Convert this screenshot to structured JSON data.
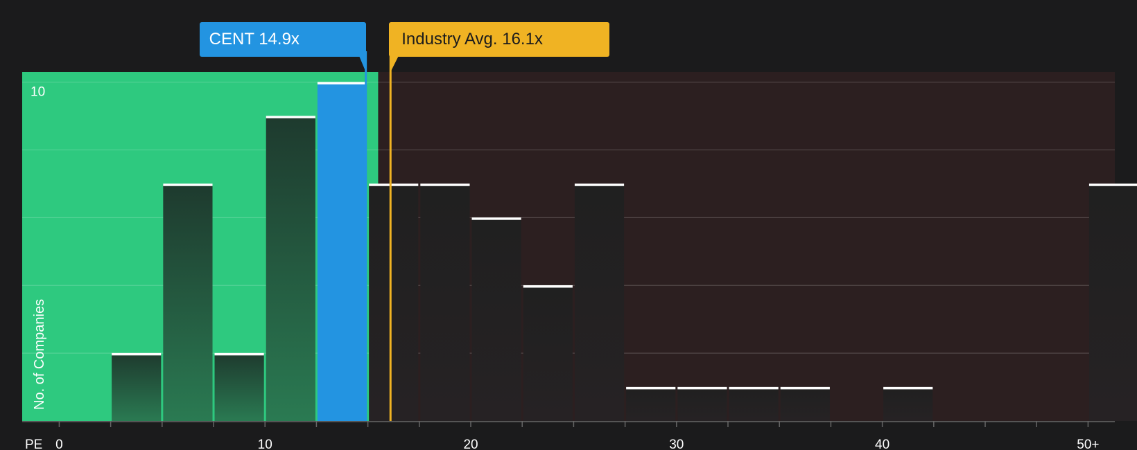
{
  "chart_data": {
    "type": "bar",
    "xlabel": "PE",
    "ylabel": "No. of Companies",
    "x_ticks": [
      {
        "value": 0,
        "label": "0"
      },
      {
        "value": 10,
        "label": "10"
      },
      {
        "value": 20,
        "label": "20"
      },
      {
        "value": 30,
        "label": "30"
      },
      {
        "value": 40,
        "label": "40"
      },
      {
        "value": 50,
        "label": "50+"
      }
    ],
    "y_ticks": [
      {
        "value": 10,
        "label": "10"
      }
    ],
    "ylim": [
      0,
      10.3
    ],
    "xlim": [
      -1.8,
      51.3
    ],
    "bin_width": 2.5,
    "bins": [
      {
        "x0": 2.5,
        "count": 2
      },
      {
        "x0": 5.0,
        "count": 7
      },
      {
        "x0": 7.5,
        "count": 2
      },
      {
        "x0": 10.0,
        "count": 9
      },
      {
        "x0": 12.5,
        "count": 10
      },
      {
        "x0": 15.0,
        "count": 7
      },
      {
        "x0": 17.5,
        "count": 7
      },
      {
        "x0": 20.0,
        "count": 6
      },
      {
        "x0": 22.5,
        "count": 4
      },
      {
        "x0": 25.0,
        "count": 7
      },
      {
        "x0": 27.5,
        "count": 1
      },
      {
        "x0": 30.0,
        "count": 1
      },
      {
        "x0": 32.5,
        "count": 1
      },
      {
        "x0": 35.0,
        "count": 1
      },
      {
        "x0": 40.0,
        "count": 1
      },
      {
        "x0": 50.0,
        "count": 7
      }
    ],
    "highlight_bin_x0": 12.5,
    "company": {
      "ticker": "CENT",
      "value": 14.9,
      "label": "CENT 14.9x"
    },
    "industry": {
      "value": 16.1,
      "label": "Industry Avg. 16.1x"
    },
    "fair_region_end": 15.5,
    "colors": {
      "background": "#1b1b1c",
      "fair_region": "#2ec97f",
      "expensive_region": "#2c1f20",
      "company": "#2394e1",
      "industry": "#f0b323",
      "bar_text": "#ffffff"
    }
  }
}
